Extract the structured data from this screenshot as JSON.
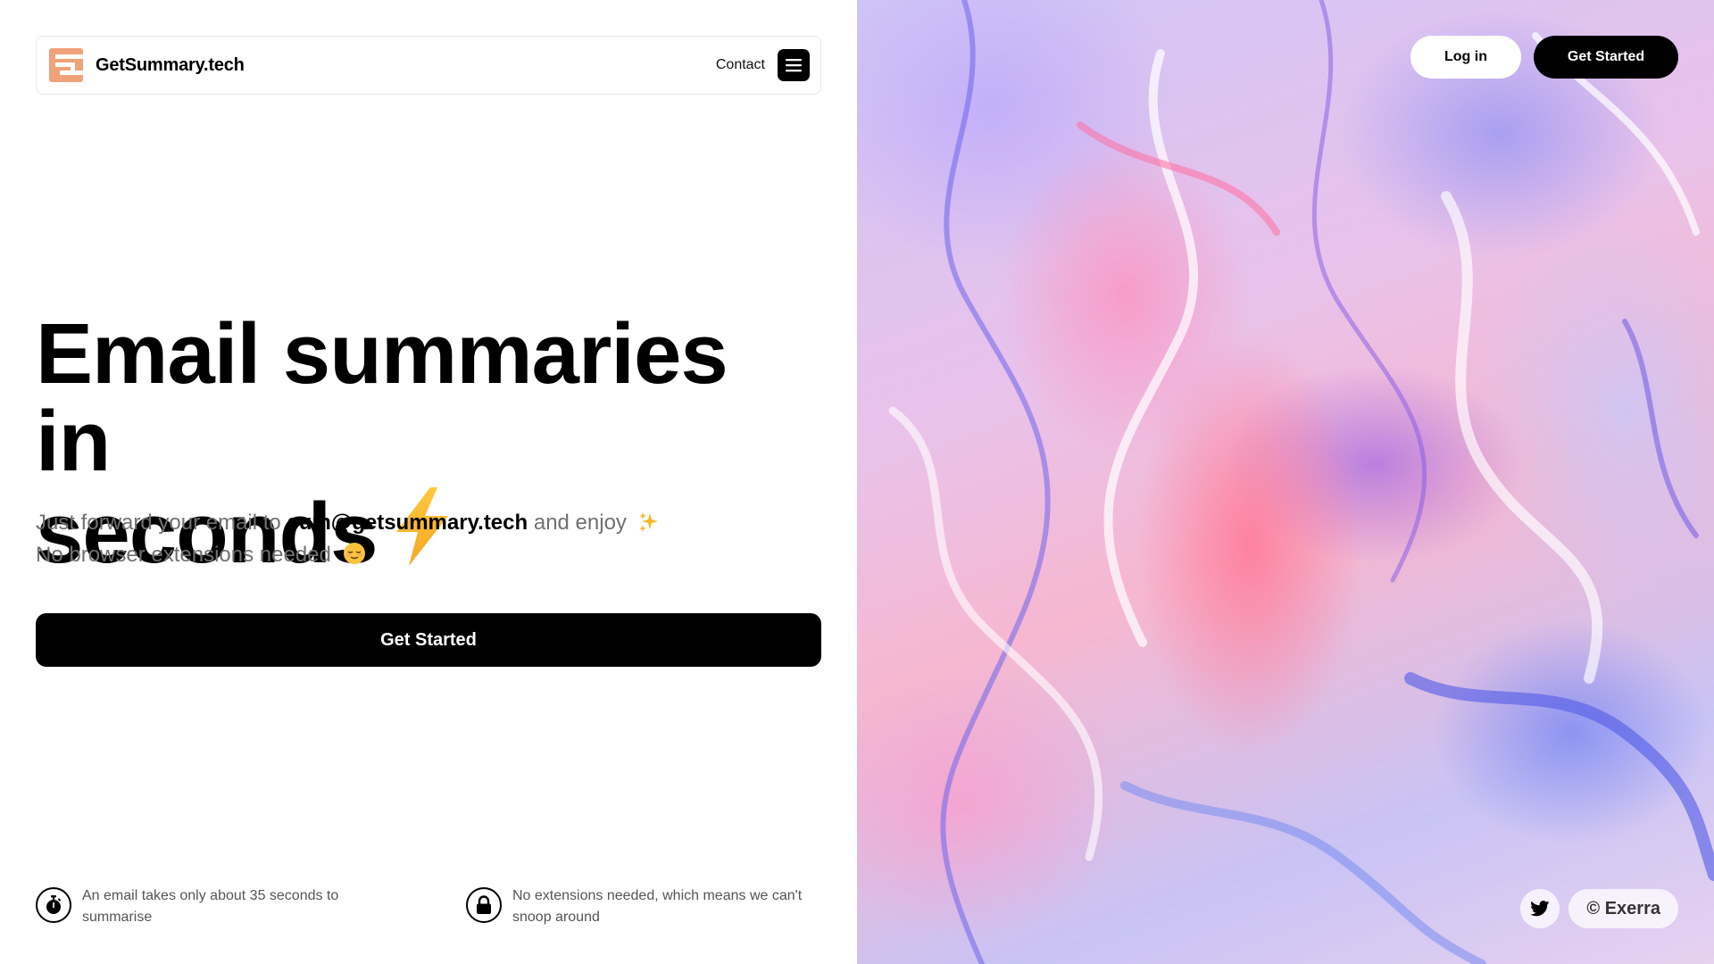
{
  "header": {
    "brand_name": "GetSummary.tech",
    "logo_icon": "getsummary-logo",
    "contact_label": "Contact",
    "menu_icon": "hamburger-menu-icon"
  },
  "hero": {
    "title_line1": "Email summaries in",
    "title_line2": "seconds",
    "title_emoji": "⚡",
    "subtitle_prefix": "Just forward your email to",
    "subtitle_email": "sum@getsummary.tech",
    "subtitle_suffix": "and enjoy",
    "subtitle_emoji_1": "✨",
    "subtitle_line2": "No browser extensions needed",
    "subtitle_emoji_2": "😌",
    "cta_label": "Get Started"
  },
  "features": [
    {
      "icon": "stopwatch-icon",
      "text": "An email takes only about 35 seconds to summarise"
    },
    {
      "icon": "lock-icon",
      "text": "No extensions needed, which means we can't snoop around"
    }
  ],
  "auth": {
    "login_label": "Log in",
    "get_started_label": "Get Started"
  },
  "footer": {
    "twitter_icon": "twitter-icon",
    "credit_label": "© Exerra"
  },
  "colors": {
    "brand_orange": "#F0A27A",
    "primary": "#000000",
    "muted_text": "#707070"
  }
}
